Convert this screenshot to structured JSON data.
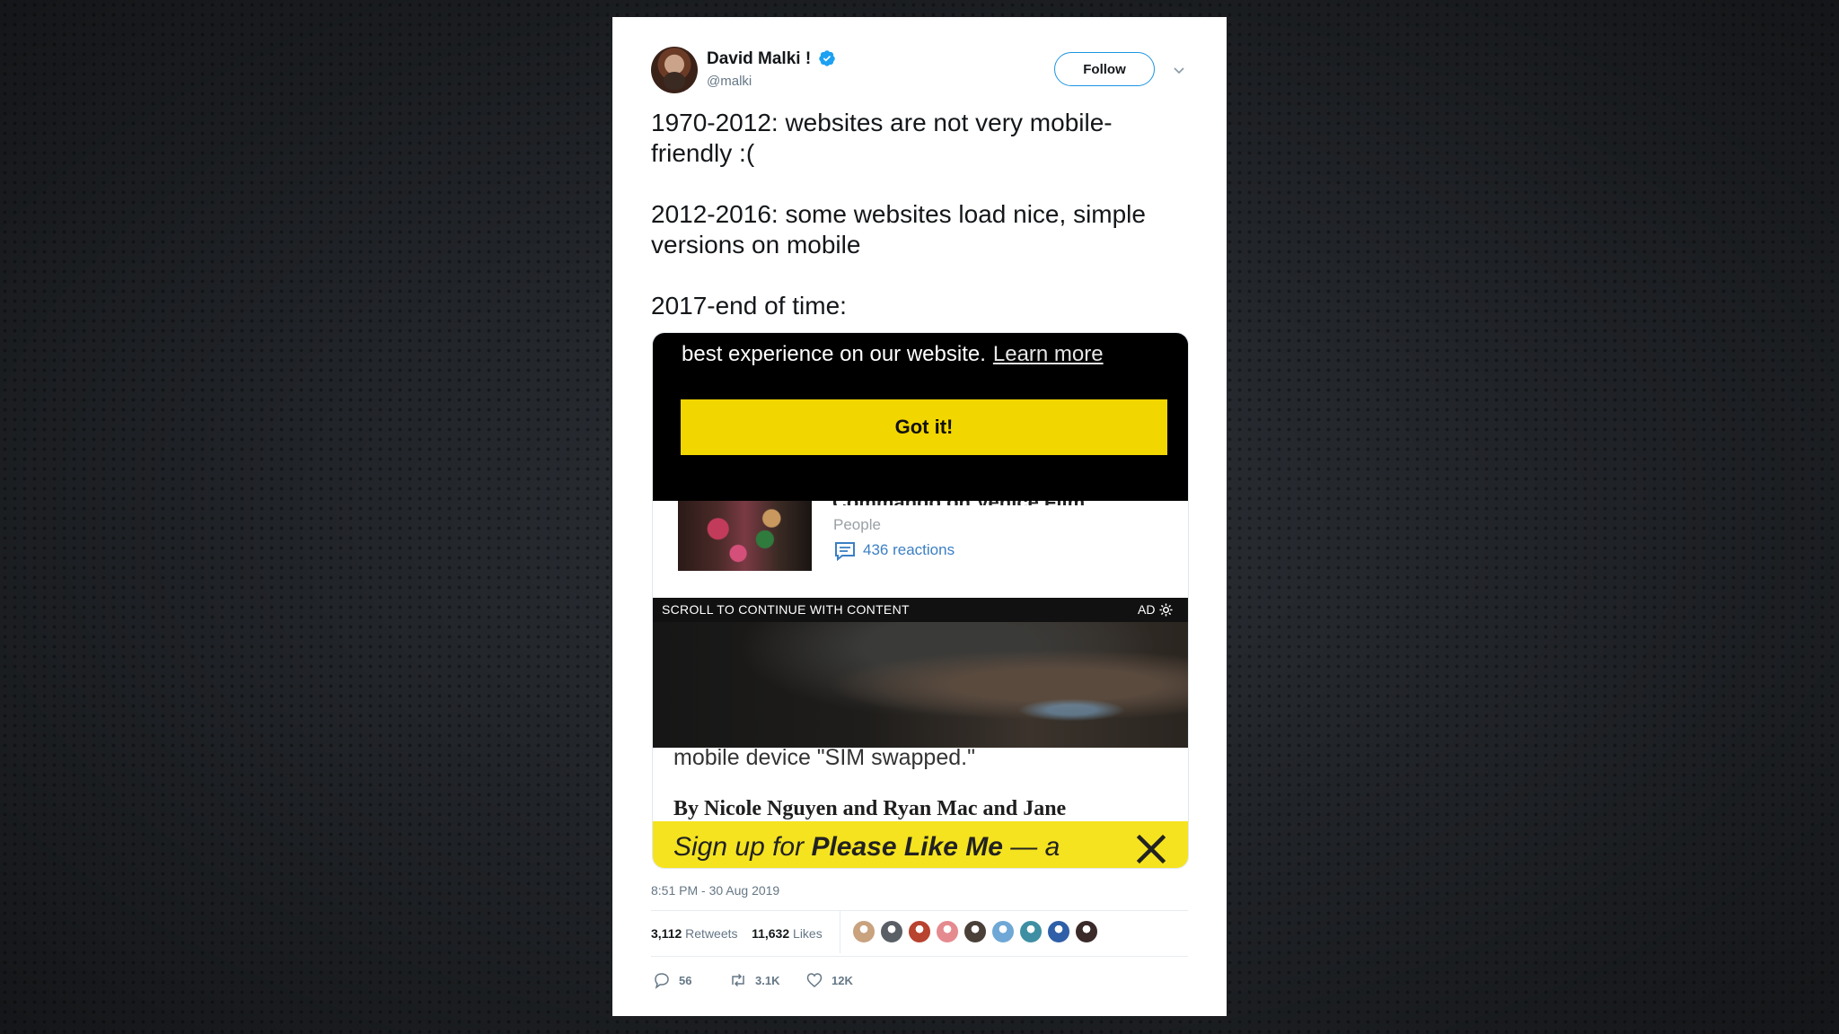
{
  "tweet": {
    "author_name": "David Malki !",
    "handle": "@malki",
    "follow_label": "Follow",
    "lines": [
      "1970-2012: websites are not very mobile-",
      "friendly :(",
      "2012-2016: some websites load nice, simple",
      "versions on mobile",
      "2017-end of time:"
    ],
    "timestamp": "8:51 PM - 30 Aug 2019",
    "retweets_count": "3,112",
    "retweets_label": "Retweets",
    "likes_count": "11,632",
    "likes_label": "Likes",
    "replies_short": "56",
    "retweets_short": "3.1K",
    "likes_short": "12K"
  },
  "media": {
    "cookie_text": "best experience on our website.",
    "learn_more": "Learn more",
    "got_it": "Got it!",
    "article_title": "Commando on Venice Film ...",
    "article_source": "People",
    "reactions": "436 reactions",
    "ad_scroll_text": "SCROLL TO CONTINUE WITH CONTENT",
    "ad_label": "AD",
    "body_text": "mobile device \"SIM swapped.\"",
    "byline": "By Nicole Nguyen and Ryan Mac and Jane",
    "signup_prefix": "Sign up for ",
    "signup_strong": "Please Like Me",
    "signup_suffix": " — a"
  },
  "colors": {
    "accent": "#1b95e0",
    "cookie_button": "#f2d600",
    "signup_bar": "#f5e31f"
  },
  "likers": [
    "#c9a27e",
    "#5a5f66",
    "#b8432f",
    "#e58a8f",
    "#4a4038",
    "#6fa8d6",
    "#3f8fa4",
    "#2f5fa8",
    "#3a2a2a"
  ]
}
